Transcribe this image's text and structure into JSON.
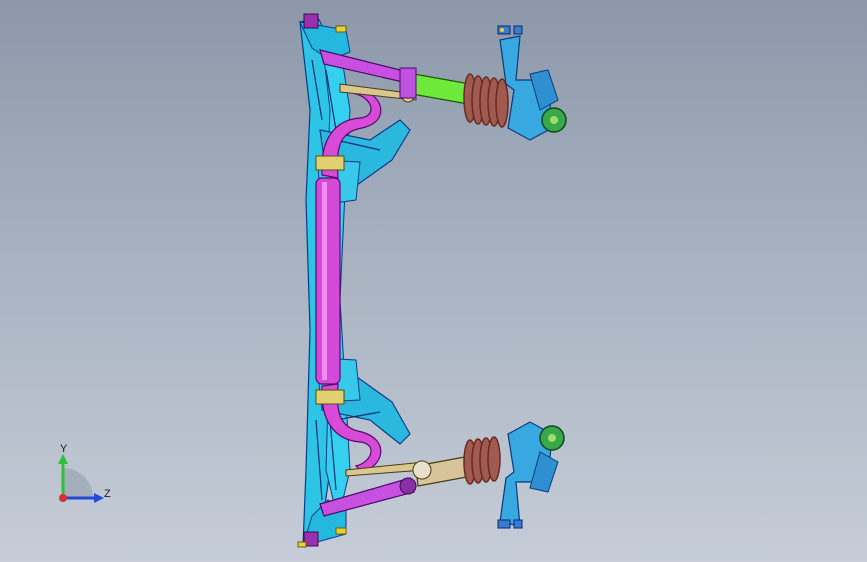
{
  "viewport": {
    "background_top": "#8c98aa",
    "background_bottom": "#c6cdd8"
  },
  "triad": {
    "y_label": "Y",
    "z_label": "Z",
    "y_color": "#2fbf3a",
    "z_color": "#2449d8",
    "x_color": "#d83030"
  },
  "model": {
    "subframe_color": "#28c8e8",
    "stabilizer_bar_color": "#d040d8",
    "lower_arm_color": "#c050e0",
    "strut_green": "#6ee83a",
    "strut_tan": "#d8c49a",
    "spring_color": "#a05a50",
    "knuckle_color": "#38a8e0",
    "hub_color": "#3aa84a",
    "bushing_color": "#9a2fb0",
    "bolt_color": "#e8d230"
  }
}
